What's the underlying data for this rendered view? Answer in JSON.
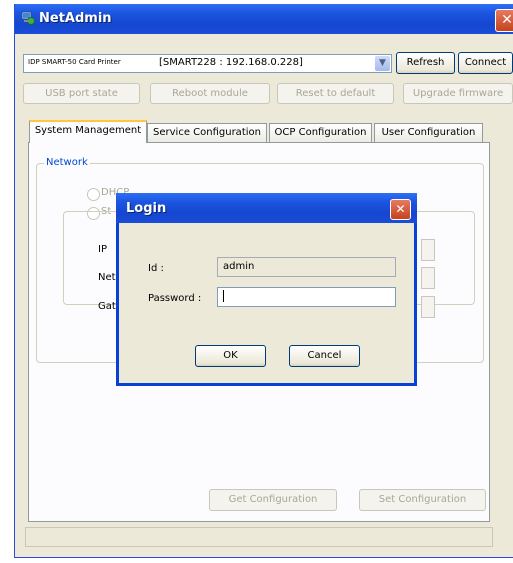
{
  "window": {
    "title": "NetAdmin",
    "icon": "network-computer-icon",
    "close_glyph": "✕"
  },
  "device": {
    "name": "IDP SMART-50 Card Printer",
    "address": "[SMART228 : 192.168.0.228]",
    "dropdown_glyph": "▼"
  },
  "toolbar": {
    "refresh_label": "Refresh",
    "connect_label": "Connect"
  },
  "actions": {
    "usb_label": "USB port state",
    "reboot_label": "Reboot module",
    "reset_label": "Reset to default",
    "upgrade_label": "Upgrade firmware"
  },
  "tabs": [
    {
      "label": "System Management",
      "active": true
    },
    {
      "label": "Service Configuration",
      "active": false
    },
    {
      "label": "OCP Configuration",
      "active": false
    },
    {
      "label": "User Configuration",
      "active": false
    }
  ],
  "network": {
    "legend": "Network",
    "dhcp_label": "DHCP",
    "static_label": "St",
    "ip_label": "IP",
    "netmask_label": "Net",
    "gateway_label": "Gat"
  },
  "bottom": {
    "get_label": "Get Configuration",
    "set_label": "Set Configuration"
  },
  "login": {
    "title": "Login",
    "close_glyph": "✕",
    "id_label": "Id :",
    "id_value": "admin",
    "password_label": "Password :",
    "password_value": "",
    "ok_label": "OK",
    "cancel_label": "Cancel"
  },
  "colors": {
    "title_blue": "#1546cf",
    "face": "#ece9d8",
    "tab_highlight": "#ffc83c",
    "legend_blue": "#0046d5",
    "close_red": "#d6492b"
  }
}
